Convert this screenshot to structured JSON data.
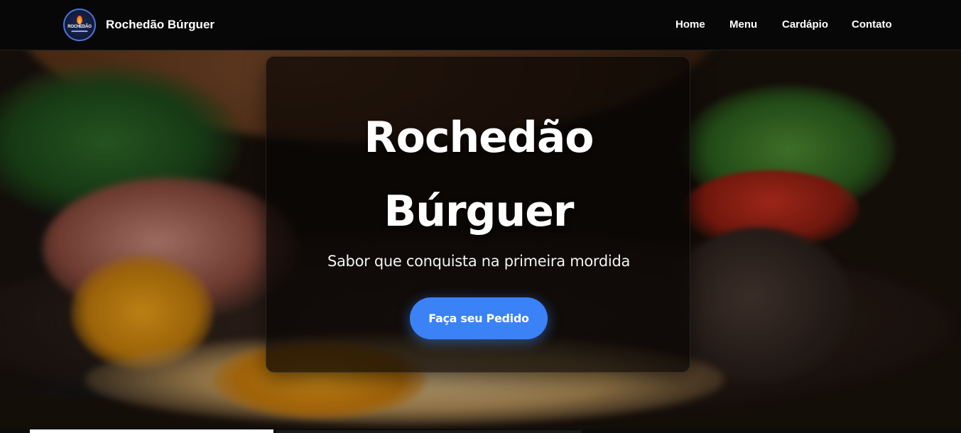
{
  "nav": {
    "logo_text": "ROCHEDÃO",
    "brand": "Rochedão Búrguer",
    "links": [
      "Home",
      "Menu",
      "Cardápio",
      "Contato"
    ]
  },
  "hero": {
    "title": "Rochedão Búrguer",
    "subtitle": "Sabor que conquista na primeira mordida",
    "cta": "Faça seu Pedido"
  },
  "colors": {
    "navbar_bg": "#070707",
    "cta_bg": "#3b82f6",
    "card_bg": "rgba(8,6,4,0.72)",
    "text": "#ffffff"
  },
  "icons": {
    "logo": "flame-logo-icon"
  }
}
